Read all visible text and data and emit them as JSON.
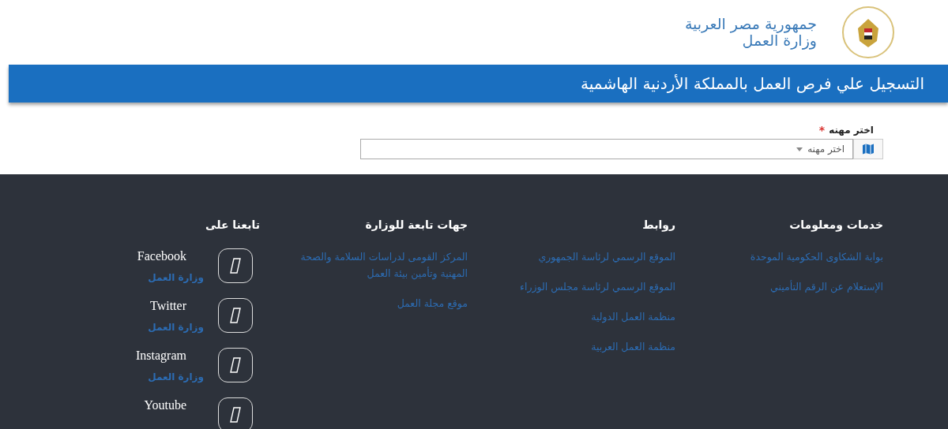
{
  "header": {
    "country": "جمهورية مصر العربية",
    "ministry": "وزارة العمل"
  },
  "banner": {
    "title": "التسجيل علي فرص العمل بالمملكة الأردنية الهاشمية"
  },
  "form": {
    "label": "اختر مهنه",
    "required_mark": "*",
    "select": {
      "placeholder": "اختر مهنه"
    }
  },
  "footer": {
    "columns": [
      {
        "title": "خدمات ومعلومات",
        "links": [
          "بوابة الشكاوى الحكومية الموحدة",
          "الإستعلام عن الرقم التأميني"
        ]
      },
      {
        "title": "روابط",
        "links": [
          "الموقع الرسمي لرئاسة الجمهوري",
          "الموقع الرسمي لرئاسة مجلس الوزراء",
          "منظمة العمل الدولية",
          "منظمة العمل العربية"
        ]
      },
      {
        "title": "جهات تابعة للوزارة",
        "links": [
          "المركز القومى لدراسات السلامة والصحة المهنية وتأمين بيئة العمل",
          "موقع مجلة العمل"
        ]
      }
    ],
    "social": {
      "title": "تابعنا على",
      "items": [
        {
          "name": "Facebook",
          "account": "وزارة العمل"
        },
        {
          "name": "Twitter",
          "account": "وزارة العمل"
        },
        {
          "name": "Instagram",
          "account": "وزارة العمل"
        },
        {
          "name": "Youtube"
        }
      ]
    }
  }
}
